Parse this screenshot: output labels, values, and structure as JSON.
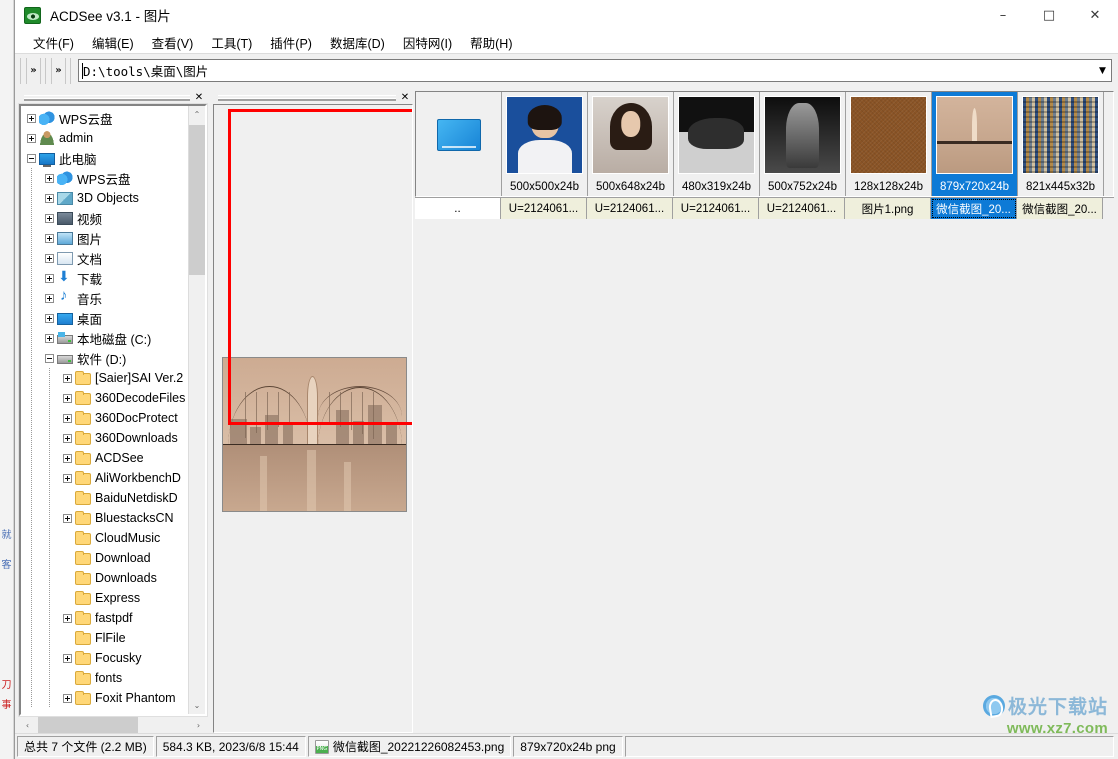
{
  "window": {
    "title": "ACDSee v3.1 - 图片",
    "app_icon": "acdsee-eye-icon",
    "controls": {
      "minimize": "–",
      "maximize": "□",
      "close": "✕"
    }
  },
  "menubar": {
    "items": [
      {
        "label": "文件(F)",
        "name": "menu-file"
      },
      {
        "label": "编辑(E)",
        "name": "menu-edit"
      },
      {
        "label": "查看(V)",
        "name": "menu-view"
      },
      {
        "label": "工具(T)",
        "name": "menu-tools"
      },
      {
        "label": "插件(P)",
        "name": "menu-plugins"
      },
      {
        "label": "数据库(D)",
        "name": "menu-database"
      },
      {
        "label": "因特网(I)",
        "name": "menu-internet"
      },
      {
        "label": "帮助(H)",
        "name": "menu-help"
      }
    ]
  },
  "toolbar": {
    "overflow_1": "»",
    "overflow_2": "»",
    "address_value": "D:\\tools\\桌面\\图片",
    "address_dropdown": "▼"
  },
  "tree_pane": {
    "close_label": "✕",
    "nodes": [
      {
        "label": "WPS云盘",
        "indent": 0,
        "expander": "plus",
        "icon": "cloud"
      },
      {
        "label": "admin",
        "indent": 0,
        "expander": "plus",
        "icon": "user"
      },
      {
        "label": "此电脑",
        "indent": 0,
        "expander": "minus",
        "icon": "pc"
      },
      {
        "label": "WPS云盘",
        "indent": 1,
        "expander": "plus",
        "icon": "cloud"
      },
      {
        "label": "3D Objects",
        "indent": 1,
        "expander": "plus",
        "icon": "cube"
      },
      {
        "label": "视频",
        "indent": 1,
        "expander": "plus",
        "icon": "video"
      },
      {
        "label": "图片",
        "indent": 1,
        "expander": "plus",
        "icon": "pics"
      },
      {
        "label": "文档",
        "indent": 1,
        "expander": "plus",
        "icon": "docs"
      },
      {
        "label": "下载",
        "indent": 1,
        "expander": "plus",
        "icon": "dl"
      },
      {
        "label": "音乐",
        "indent": 1,
        "expander": "plus",
        "icon": "music"
      },
      {
        "label": "桌面",
        "indent": 1,
        "expander": "plus",
        "icon": "desktop"
      },
      {
        "label": "本地磁盘 (C:)",
        "indent": 1,
        "expander": "plus",
        "icon": "drive win"
      },
      {
        "label": "软件 (D:)",
        "indent": 1,
        "expander": "minus",
        "icon": "drive"
      },
      {
        "label": "[Saier]SAI Ver.2",
        "indent": 2,
        "expander": "plus",
        "icon": "folder"
      },
      {
        "label": "360DecodeFiles",
        "indent": 2,
        "expander": "plus",
        "icon": "folder"
      },
      {
        "label": "360DocProtect",
        "indent": 2,
        "expander": "plus",
        "icon": "folder"
      },
      {
        "label": "360Downloads",
        "indent": 2,
        "expander": "plus",
        "icon": "folder"
      },
      {
        "label": "ACDSee",
        "indent": 2,
        "expander": "plus",
        "icon": "folder"
      },
      {
        "label": "AliWorkbenchD",
        "indent": 2,
        "expander": "plus",
        "icon": "folder"
      },
      {
        "label": "BaiduNetdiskD",
        "indent": 2,
        "expander": "none",
        "icon": "folder"
      },
      {
        "label": "BluestacksCN",
        "indent": 2,
        "expander": "plus",
        "icon": "folder"
      },
      {
        "label": "CloudMusic",
        "indent": 2,
        "expander": "none",
        "icon": "folder"
      },
      {
        "label": "Download",
        "indent": 2,
        "expander": "none",
        "icon": "folder"
      },
      {
        "label": "Downloads",
        "indent": 2,
        "expander": "none",
        "icon": "folder"
      },
      {
        "label": "Express",
        "indent": 2,
        "expander": "none",
        "icon": "folder"
      },
      {
        "label": "fastpdf",
        "indent": 2,
        "expander": "plus",
        "icon": "folder"
      },
      {
        "label": "FlFile",
        "indent": 2,
        "expander": "none",
        "icon": "folder"
      },
      {
        "label": "Focusky",
        "indent": 2,
        "expander": "plus",
        "icon": "folder"
      },
      {
        "label": "fonts",
        "indent": 2,
        "expander": "none",
        "icon": "folder"
      },
      {
        "label": "Foxit Phantom",
        "indent": 2,
        "expander": "plus",
        "icon": "folder"
      }
    ],
    "scroll_up": "⌃",
    "scroll_down": "⌄",
    "scroll_left": "‹",
    "scroll_right": "›"
  },
  "preview_pane": {
    "close_label": "✕",
    "image_name": "bridge-preview",
    "annotation_color": "#ff0000"
  },
  "thumbnails": {
    "items": [
      {
        "dim": "",
        "caption": "..",
        "art": "monitor",
        "selected": false,
        "parent": true
      },
      {
        "dim": "500x500x24b",
        "caption": "U=2124061...",
        "art": "idphoto-blue",
        "selected": false
      },
      {
        "dim": "500x648x24b",
        "caption": "U=2124061...",
        "art": "idphoto-gray",
        "selected": false
      },
      {
        "dim": "480x319x24b",
        "caption": "U=2124061...",
        "art": "rockbw",
        "selected": false
      },
      {
        "dim": "500x752x24b",
        "caption": "U=2124061...",
        "art": "statuebw",
        "selected": false
      },
      {
        "dim": "128x128x24b",
        "caption": "图片1.png",
        "art": "leather",
        "selected": false
      },
      {
        "dim": "879x720x24b",
        "caption": "微信截图_20...",
        "art": "bridge",
        "selected": true
      },
      {
        "dim": "821x445x32b",
        "caption": "微信截图_20...",
        "art": "crowd",
        "selected": false
      }
    ]
  },
  "statusbar": {
    "total": "总共 7 个文件 (2.2 MB)",
    "filesize_date": "584.3 KB, 2023/6/8 15:44",
    "filename": "微信截图_20221226082453.png",
    "file_icon": "png-file-icon",
    "format": "879x720x24b png"
  },
  "watermark": {
    "cn": "极光下载站",
    "url": "www.xz7.com"
  },
  "background": {
    "left_fragments": [
      "就",
      "客",
      "刀",
      "事"
    ]
  }
}
